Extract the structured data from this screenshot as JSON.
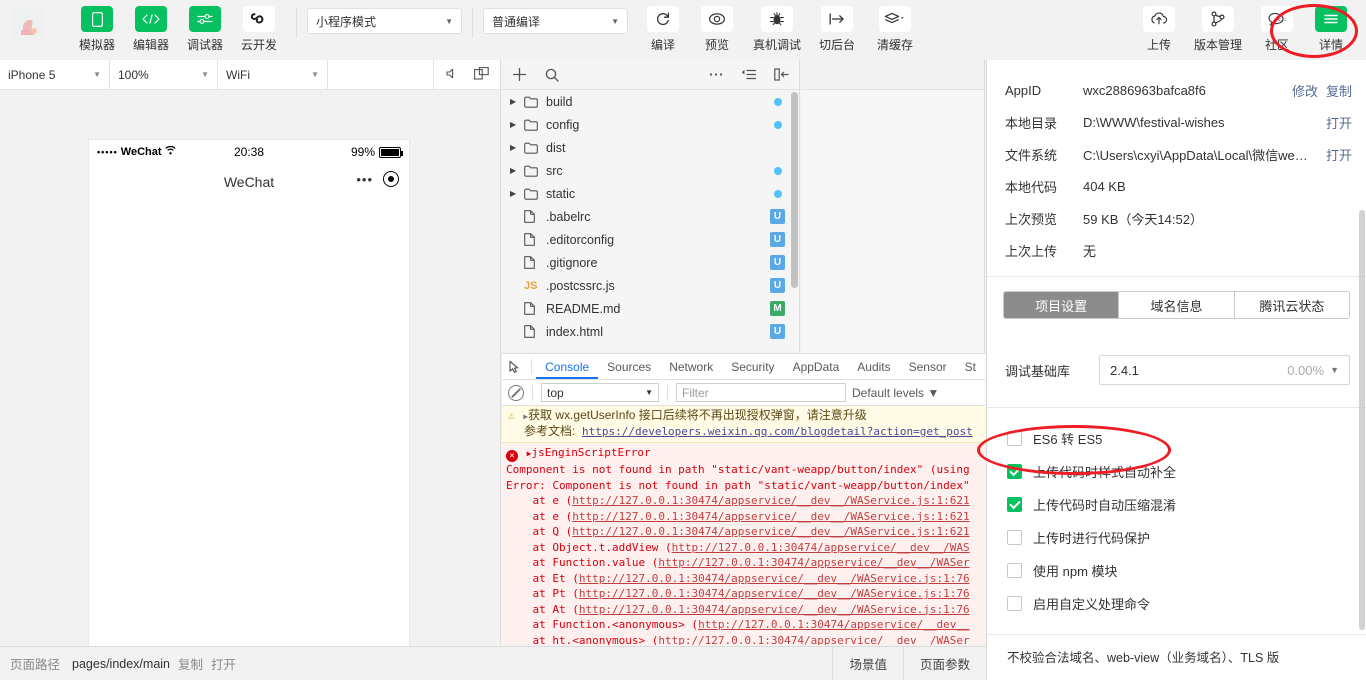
{
  "toolbar": {
    "logo_icon": "app-logo",
    "buttons": [
      {
        "label": "模拟器",
        "icon": "phone-icon",
        "active": true
      },
      {
        "label": "编辑器",
        "icon": "code-icon",
        "active": true
      },
      {
        "label": "调试器",
        "icon": "sliders-icon",
        "active": true
      },
      {
        "label": "云开发",
        "icon": "cloud-dev-icon",
        "active": false
      }
    ],
    "mode_select": {
      "value": "小程序模式",
      "icon": "chevron-down-icon"
    },
    "compile_select": {
      "value": "普通编译",
      "icon": "chevron-down-icon"
    },
    "actions": [
      {
        "label": "编译",
        "icon": "refresh-icon"
      },
      {
        "label": "预览",
        "icon": "eye-icon"
      },
      {
        "label": "真机调试",
        "icon": "bug-icon"
      },
      {
        "label": "切后台",
        "icon": "background-icon"
      },
      {
        "label": "清缓存",
        "icon": "layers-icon"
      }
    ],
    "right_actions": [
      {
        "label": "上传",
        "icon": "upload-cloud-icon"
      },
      {
        "label": "版本管理",
        "icon": "branch-icon"
      },
      {
        "label": "社区",
        "icon": "community-icon"
      },
      {
        "label": "详情",
        "icon": "hamburger-icon",
        "highlighted": true
      }
    ]
  },
  "simulator": {
    "device_select": "iPhone 5",
    "zoom_select": "100%",
    "network_select": "WiFi",
    "icons": [
      "volume-icon",
      "rotate-screen-icon"
    ],
    "phone": {
      "carrier_dots": "•••••",
      "carrier": "WeChat",
      "wifi_icon": "wifi-icon",
      "time": "20:38",
      "battery_percent": "99%",
      "battery_icon": "battery-icon",
      "nav_title": "WeChat",
      "capsule_more_icon": "more-dots-icon",
      "capsule_target_icon": "target-circle-icon"
    }
  },
  "file_tree": {
    "toolbar_icons": [
      "add-icon",
      "search-icon",
      "more-icon",
      "collapse-icon",
      "sidebar-toggle-icon"
    ],
    "items": [
      {
        "name": "build",
        "type": "folder",
        "arrow": "▶",
        "status": "dot"
      },
      {
        "name": "config",
        "type": "folder",
        "arrow": "▶",
        "status": "dot"
      },
      {
        "name": "dist",
        "type": "folder",
        "arrow": "▶",
        "status": ""
      },
      {
        "name": "src",
        "type": "folder",
        "arrow": "▶",
        "status": "dot"
      },
      {
        "name": "static",
        "type": "folder",
        "arrow": "▶",
        "status": "dot"
      },
      {
        "name": ".babelrc",
        "type": "file",
        "arrow": "",
        "status": "U"
      },
      {
        "name": ".editorconfig",
        "type": "file",
        "arrow": "",
        "status": "U"
      },
      {
        "name": ".gitignore",
        "type": "file",
        "arrow": "",
        "status": "U"
      },
      {
        "name": ".postcssrc.js",
        "type": "js",
        "arrow": "",
        "status": "U"
      },
      {
        "name": "README.md",
        "type": "file",
        "arrow": "",
        "status": "M"
      },
      {
        "name": "index.html",
        "type": "file",
        "arrow": "",
        "status": "U"
      }
    ]
  },
  "devtools": {
    "inspect_icon": "inspect-element-icon",
    "tabs": [
      {
        "label": "Console",
        "active": true
      },
      {
        "label": "Sources",
        "active": false
      },
      {
        "label": "Network",
        "active": false
      },
      {
        "label": "Security",
        "active": false
      },
      {
        "label": "AppData",
        "active": false
      },
      {
        "label": "Audits",
        "active": false
      },
      {
        "label": "Sensor",
        "active": false
      },
      {
        "label": "St",
        "active": false
      }
    ],
    "clear_icon": "clear-console-icon",
    "context": "top",
    "filter_placeholder": "Filter",
    "levels": "Default levels",
    "warning": {
      "icon": "warning-triangle-icon",
      "line1": "获取 wx.getUserInfo 接口后续将不再出现授权弹窗，请注意升级",
      "line2_label": "参考文档:",
      "line2_link": "https://developers.weixin.qq.com/blogdetail?action=get_post"
    },
    "error": {
      "icon": "error-circle-icon",
      "title": "jsEnginScriptError",
      "lines": [
        "Component is not found in path \"static/vant-weapp/button/index\" (using",
        "Error: Component is not found in path \"static/vant-weapp/button/index\"",
        "    at e (http://127.0.0.1:30474/appservice/__dev__/WAService.js:1:621",
        "    at e (http://127.0.0.1:30474/appservice/__dev__/WAService.js:1:621",
        "    at Q (http://127.0.0.1:30474/appservice/__dev__/WAService.js:1:621",
        "    at Object.t.addView (http://127.0.0.1:30474/appservice/__dev__/WAS",
        "    at Function.value (http://127.0.0.1:30474/appservice/__dev__/WASer",
        "    at Et (http://127.0.0.1:30474/appservice/__dev__/WAService.js:1:76",
        "    at Pt (http://127.0.0.1:30474/appservice/__dev__/WAService.js:1:76",
        "    at At (http://127.0.0.1:30474/appservice/__dev__/WAService.js:1:76",
        "    at Function.<anonymous> (http://127.0.0.1:30474/appservice/__dev__",
        "    at ht.<anonymous> (http://127.0.0.1:30474/appservice/__dev__/WASer"
      ]
    },
    "prompt": "›"
  },
  "detail": {
    "info_rows": [
      {
        "label": "AppID",
        "value": "wxc2886963bafca8f6",
        "actions": [
          "修改",
          "复制"
        ]
      },
      {
        "label": "本地目录",
        "value": "D:\\WWW\\festival-wishes",
        "actions": [
          "打开"
        ]
      },
      {
        "label": "文件系统",
        "value": "C:\\Users\\cxyi\\AppData\\Local\\微信web开...",
        "actions": [
          "打开"
        ]
      },
      {
        "label": "本地代码",
        "value": "404 KB",
        "actions": []
      },
      {
        "label": "上次预览",
        "value": "59 KB（今天14:52）",
        "actions": []
      },
      {
        "label": "上次上传",
        "value": "无",
        "actions": []
      }
    ],
    "segments": [
      {
        "label": "项目设置",
        "active": true
      },
      {
        "label": "域名信息",
        "active": false
      },
      {
        "label": "腾讯云状态",
        "active": false
      }
    ],
    "library": {
      "label": "调试基础库",
      "version": "2.4.1",
      "percent": "0.00%",
      "icon": "chevron-down-icon"
    },
    "options": [
      {
        "label": "ES6 转 ES5",
        "checked": false,
        "highlighted": true
      },
      {
        "label": "上传代码时样式自动补全",
        "checked": true,
        "highlighted": false
      },
      {
        "label": "上传代码时自动压缩混淆",
        "checked": true,
        "highlighted": false
      },
      {
        "label": "上传时进行代码保护",
        "checked": false,
        "highlighted": false
      },
      {
        "label": "使用 npm 模块",
        "checked": false,
        "highlighted": false
      },
      {
        "label": "启用自定义处理命令",
        "checked": false,
        "highlighted": false
      }
    ],
    "foot_note": "不校验合法域名、web-view（业务域名）、TLS 版"
  },
  "statusbar": {
    "path_label": "页面路径",
    "path_value": "pages/index/main",
    "copy_label": "复制",
    "open_label": "打开",
    "scene_button": "场景值",
    "params_button": "页面参数"
  },
  "colors": {
    "accent_green": "#07c160",
    "annotation_red": "#ee1c25",
    "link_blue": "#576b95",
    "tab_active_blue": "#1a73e8"
  }
}
